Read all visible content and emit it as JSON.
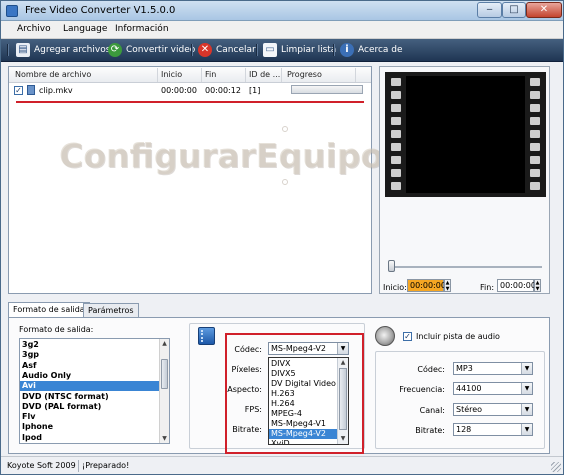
{
  "window": {
    "title": "Free Video Converter V1.5.0.0"
  },
  "menu": {
    "items": [
      "Archivo",
      "Language",
      "Información"
    ]
  },
  "toolbar": {
    "add_files": "Agregar archivos",
    "convert": "Convertir video",
    "cancel": "Cancelar",
    "clear_list": "Limpiar lista",
    "about": "Acerca de"
  },
  "file_list": {
    "columns": [
      "Nombre de archivo",
      "Inicio",
      "Fin",
      "ID de ...",
      "Progreso"
    ],
    "rows": [
      {
        "checked": true,
        "name": "clip.mkv",
        "start": "00:00:00",
        "end": "00:00:12",
        "id": "[1]",
        "progress": 0
      }
    ]
  },
  "watermark": {
    "text": "ConfigurarEquipos"
  },
  "preview": {
    "start_label": "Inicio:",
    "start_value": "00:00:00",
    "end_label": "Fin:",
    "end_value": "00:00:00"
  },
  "tabs": [
    "Formato de salida",
    "Parámetros"
  ],
  "output_format": {
    "label": "Formato de salida:",
    "items": [
      "3g2",
      "3gp",
      "Asf",
      "Audio Only",
      "Avi",
      "DVD (NTSC format)",
      "DVD (PAL format)",
      "Flv",
      "Iphone",
      "Ipod"
    ],
    "selected": "Avi"
  },
  "video": {
    "codec_label": "Códec:",
    "codec_value": "MS-Mpeg4-V2",
    "pixels_label": "Píxeles:",
    "aspect_label": "Aspecto:",
    "fps_label": "FPS:",
    "bitrate_label": "Bitrate:",
    "codec_options": [
      "DIVX",
      "DIVX5",
      "DV Digital Video",
      "H.263",
      "H.264",
      "MPEG-4",
      "MS-Mpeg4-V1",
      "MS-Mpeg4-V2",
      "XviD"
    ],
    "codec_selected": "MS-Mpeg4-V2"
  },
  "audio": {
    "include_label": "Incluir pista de audio",
    "include_checked": true,
    "codec_label": "Códec:",
    "codec_value": "MP3",
    "freq_label": "Frecuencia:",
    "freq_value": "44100",
    "channel_label": "Canal:",
    "channel_value": "Stéreo",
    "bitrate_label": "Bitrate:",
    "bitrate_value": "128"
  },
  "status": {
    "company": "Koyote Soft 2009",
    "message": "¡Preparado!"
  },
  "colors": {
    "toolbar_bg": "#2b4566",
    "selection": "#3a85d4",
    "highlight_red": "#d0202a",
    "time_active": "#f5a623"
  },
  "icons": {
    "add_files": "add-files-icon",
    "convert": "convert-video-icon",
    "cancel": "cancel-icon",
    "clear_list": "clear-list-icon",
    "about": "about-icon"
  }
}
